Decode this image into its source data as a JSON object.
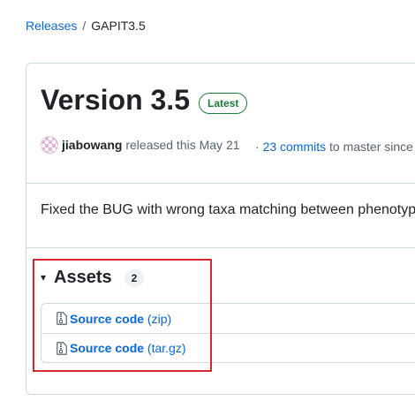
{
  "breadcrumb": {
    "parent": "Releases",
    "separator": "/",
    "current": "GAPIT3.5"
  },
  "release": {
    "title": "Version 3.5",
    "badge": "Latest",
    "author": "jiabowang",
    "released_text": "released this May 21",
    "commits_bullet": "·",
    "commits_link": "23 commits",
    "commits_suffix": "to master since",
    "body": "Fixed the BUG with wrong taxa matching between phenotyp"
  },
  "assets": {
    "caret": "▾",
    "label": "Assets",
    "count": "2",
    "items": [
      {
        "name": "Source code",
        "ext": "(zip)"
      },
      {
        "name": "Source code",
        "ext": "(tar.gz)"
      }
    ]
  },
  "colors": {
    "link": "#0969da",
    "latest_green": "#1a7f37",
    "highlight_red": "#d7282f",
    "border": "#d1d9e0"
  },
  "icons": {
    "asset_icon": "file-zip-icon"
  }
}
